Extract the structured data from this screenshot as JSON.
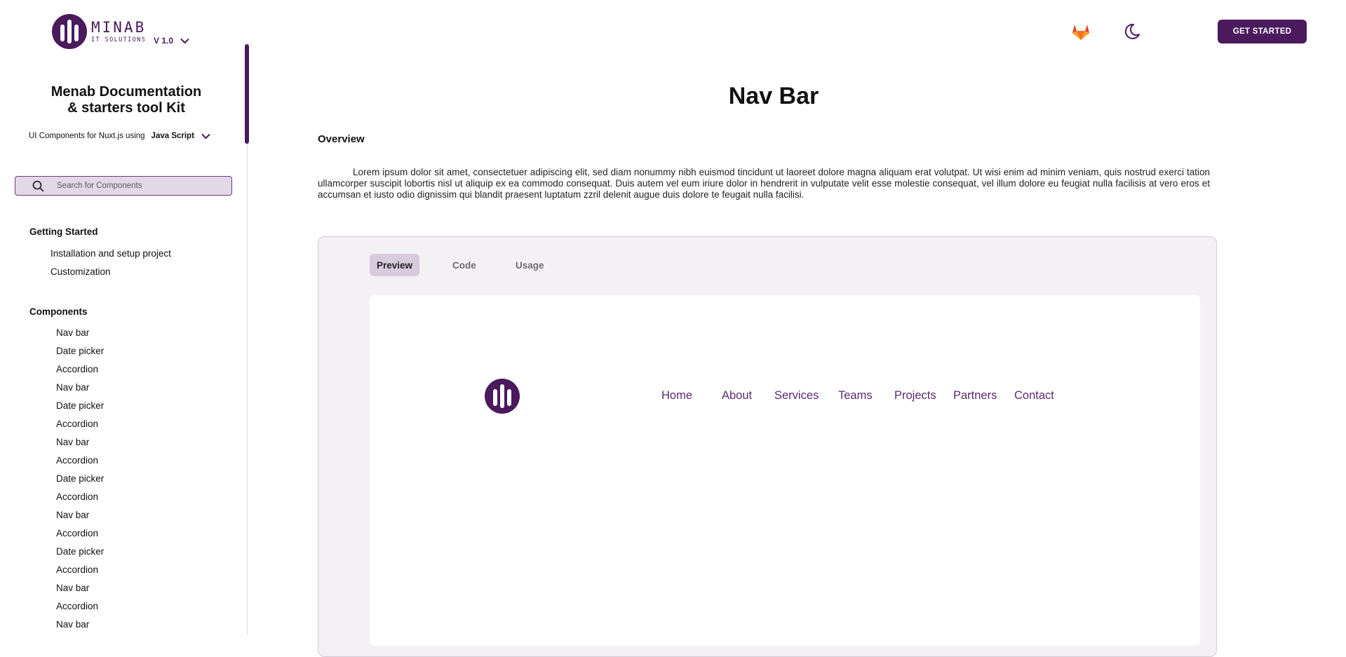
{
  "header": {
    "logo_title": "MINAB",
    "logo_subtitle": "IT SOLUTIONS",
    "version": "V 1.0",
    "cta_label": "GET STARTED",
    "icons": [
      "gitlab-icon",
      "moon-icon",
      "chevron-down-icon"
    ]
  },
  "sidebar": {
    "title_line1": "Menab Documentation",
    "title_line2": "& starters tool Kit",
    "subtitle": "UI Components for Nuxt.js using",
    "language": "Java Script",
    "search_placeholder": "Search for Components",
    "sections": [
      {
        "title": "Getting Started",
        "items": [
          "Installation and setup project",
          "Customization"
        ]
      },
      {
        "title": "Components",
        "items": [
          "Nav bar",
          "Date picker",
          "Accordion",
          "Nav bar",
          "Date picker",
          "Accordion",
          "Nav bar",
          "Accordion",
          "Date picker",
          "Accordion",
          "Nav bar",
          "Accordion",
          "Date picker",
          "Accordion",
          "Nav bar",
          "Accordion",
          "Nav bar"
        ]
      }
    ]
  },
  "main": {
    "page_title": "Nav Bar",
    "overview_heading": "Overview",
    "overview_text": "Lorem ipsum dolor sit amet, consectetuer adipiscing elit, sed diam nonummy nibh euismod tincidunt ut laoreet dolore magna aliquam erat volutpat. Ut wisi enim ad minim veniam, quis nostrud exerci tation ullamcorper suscipit lobortis nisl ut aliquip ex ea commodo consequat. Duis autem vel eum iriure dolor in hendrerit in vulputate velit esse molestie consequat, vel illum dolore eu feugiat nulla facilisis at vero eros et accumsan et iusto odio dignissim qui blandit praesent luptatum zzril delenit augue duis dolore te feugait nulla facilisi.",
    "tabs": [
      {
        "label": "Preview",
        "active": true
      },
      {
        "label": "Code",
        "active": false
      },
      {
        "label": "Usage",
        "active": false
      }
    ],
    "preview_nav_links": [
      "Home",
      "About",
      "Services",
      "Teams",
      "Projects",
      "Partners",
      "Contact"
    ]
  },
  "colors": {
    "brand": "#4a1a5c",
    "link": "#5b2a6e",
    "search_bg": "#e3d8e8",
    "tab_active_bg": "#d8cbde",
    "card_bg": "#f4f1f5"
  }
}
